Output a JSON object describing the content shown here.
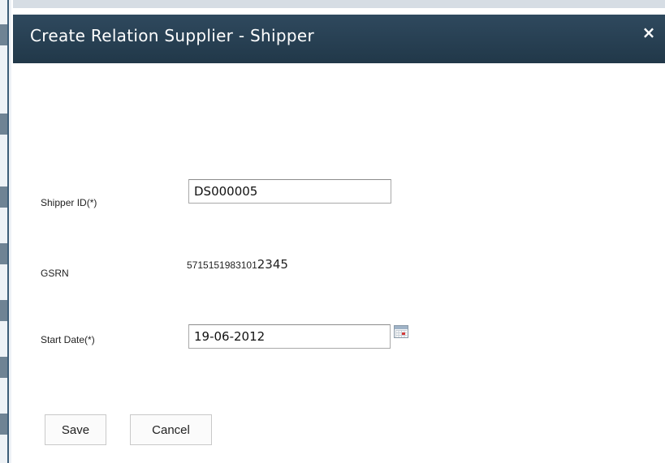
{
  "dialog": {
    "title": "Create Relation Supplier - Shipper",
    "close_glyph": "×"
  },
  "form": {
    "shipper_id_label": "Shipper ID(*)",
    "shipper_id_value": "DS000005",
    "gsrn_label": "GSRN",
    "gsrn_value_small": "5715151983101",
    "gsrn_value_large": "2345",
    "start_date_label": "Start Date(*)",
    "start_date_value": "19-06-2012"
  },
  "buttons": {
    "save_label": "Save",
    "cancel_label": "Cancel"
  },
  "icons": {
    "close": "close-icon",
    "calendar": "calendar-icon"
  },
  "colors": {
    "titlebar": "#2a4256",
    "title_text": "#ffffff"
  }
}
